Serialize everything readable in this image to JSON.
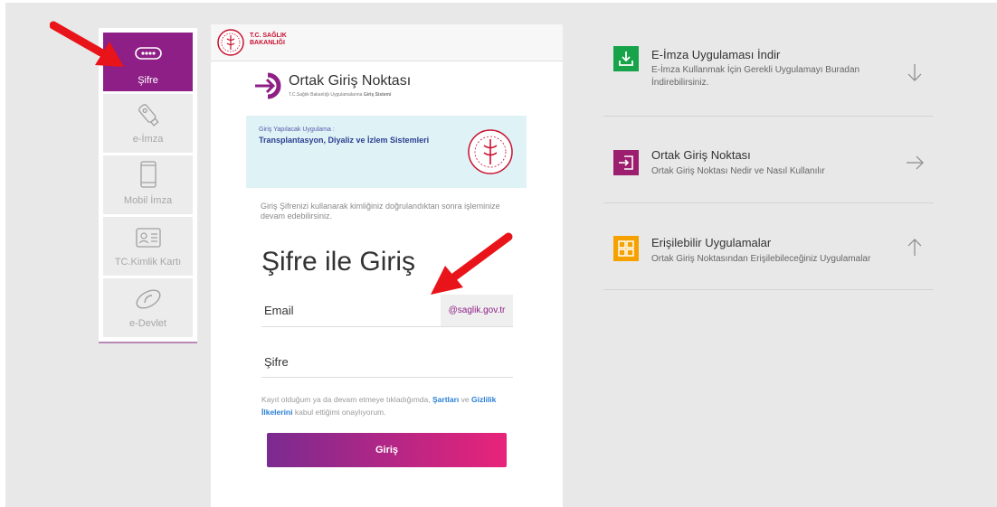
{
  "sidebar": {
    "items": [
      {
        "label": "Şifre",
        "icon": "password-dots-icon",
        "active": true
      },
      {
        "label": "e-İmza",
        "icon": "usb-token-icon",
        "active": false
      },
      {
        "label": "Mobil İmza",
        "icon": "mobile-phone-icon",
        "active": false
      },
      {
        "label": "TC.Kimlik Kartı",
        "icon": "id-card-icon",
        "active": false
      },
      {
        "label": "e-Devlet",
        "icon": "e-devlet-logo-icon",
        "active": false
      }
    ]
  },
  "card": {
    "ministry_name": "T.C. SAĞLIK BAKANLIĞI",
    "brand_title": "Ortak Giriş Noktası",
    "brand_subtitle_prefix": "T.C.Sağlık Bakanlığı Uygulamalarına",
    "brand_subtitle_bold": "Giriş Sistemi",
    "app_label": "Giriş Yapılacak Uygulama :",
    "app_name": "Transplantasyon, Diyaliz ve İzlem Sistemleri",
    "info_text": "Giriş Şifrenizi kullanarak kimliğiniz doğrulandıktan sonra işleminize devam edebilirsiniz.",
    "heading": "Şifre ile Giriş",
    "email_placeholder": "Email",
    "email_domain": "@saglik.gov.tr",
    "password_placeholder": "Şifre",
    "terms_prefix": "Kayıt olduğum ya da devam etmeye tıkladığımda, ",
    "terms_link1": "Şartları",
    "terms_middle": " ve ",
    "terms_link2": "Gizlilik İlkelerini",
    "terms_suffix": " kabul ettiğimi onaylıyorum.",
    "submit_label": "Giriş"
  },
  "right": {
    "items": [
      {
        "title": "E-İmza Uygulaması İndir",
        "desc": "E-İmza Kullanmak İçin Gerekli Uygulamayı Buradan İndirebilirsiniz.",
        "icon": "download-icon",
        "arrow": "arrow-down-icon",
        "color": "#17a34a"
      },
      {
        "title": "Ortak Giriş Noktası",
        "desc": "Ortak Giriş Noktası Nedir ve Nasıl Kullanılır",
        "icon": "sign-in-icon",
        "arrow": "arrow-right-icon",
        "color": "#9c1e6e"
      },
      {
        "title": "Erişilebilir Uygulamalar",
        "desc": "Ortak Giriş Noktasından Erişilebileceğiniz Uygulamalar",
        "icon": "apps-grid-icon",
        "arrow": "arrow-up-icon",
        "color": "#f5a200"
      }
    ]
  },
  "colors": {
    "accent": "#8e1f86",
    "link": "#2a7fd4",
    "annotation_arrow": "#e8141a"
  }
}
